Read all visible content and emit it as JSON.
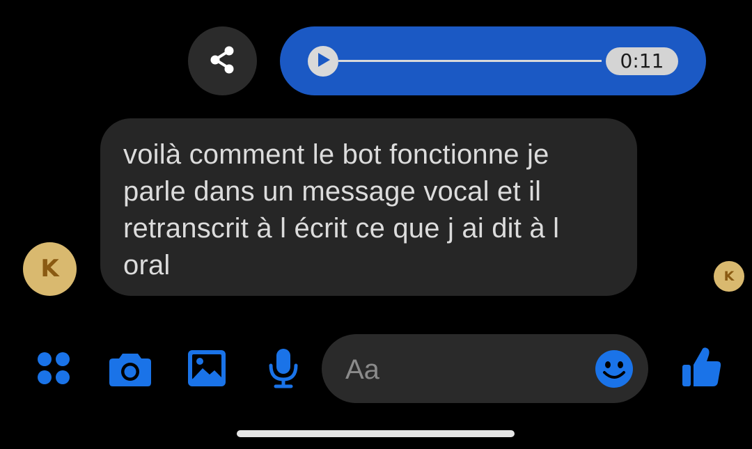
{
  "conversation": {
    "voice_message": {
      "duration": "0:11",
      "progress": 0
    },
    "incoming_message": {
      "lines": [
        "voilà comment le bot fonctionne je",
        "parle dans un message vocal et il",
        "retranscrit à l écrit ce que j ai dit à l",
        "oral"
      ],
      "sender_initial": "K"
    },
    "read_receipt_initial": "K"
  },
  "composer": {
    "placeholder": "Aa",
    "value": ""
  },
  "icons": {
    "share": "share-icon",
    "play": "play-icon",
    "apps": "apps-grid-icon",
    "camera": "camera-icon",
    "gallery": "image-icon",
    "microphone": "microphone-icon",
    "emoji": "emoji-icon",
    "like": "thumbs-up-icon"
  },
  "colors": {
    "background": "#000000",
    "accent": "#1b59c4",
    "icon_blue": "#1a73e8",
    "bubble_incoming": "#262626",
    "avatar": "#d9b96f"
  }
}
